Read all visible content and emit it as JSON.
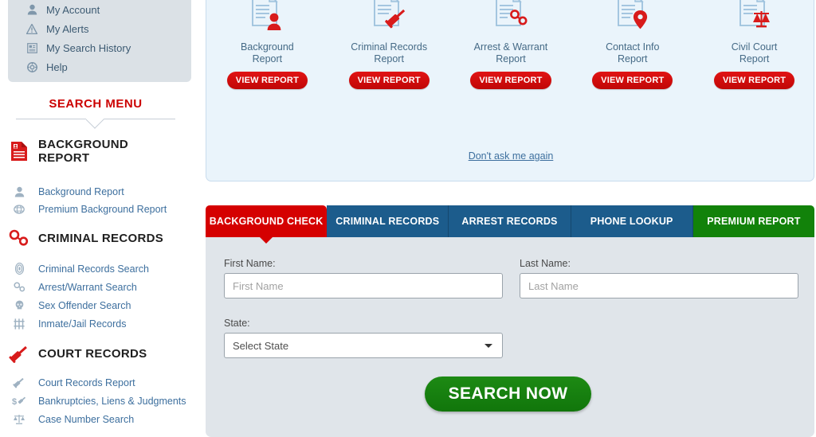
{
  "sidebar": {
    "account_items": [
      {
        "icon": "user-icon",
        "label": "My Account"
      },
      {
        "icon": "alert-triangle-icon",
        "label": "My Alerts"
      },
      {
        "icon": "history-list-icon",
        "label": "My Search History"
      },
      {
        "icon": "lifebuoy-help-icon",
        "label": "Help"
      }
    ],
    "search_menu_title": "SEARCH MENU",
    "sections": [
      {
        "icon": "background-report-document-icon",
        "title": "BACKGROUND REPORT",
        "items": [
          {
            "icon": "person-icon",
            "label": "Background Report"
          },
          {
            "icon": "globe-icon",
            "label": "Premium Background Report"
          }
        ]
      },
      {
        "icon": "handcuffs-icon",
        "title": "CRIMINAL RECORDS",
        "items": [
          {
            "icon": "fingerprint-icon",
            "label": "Criminal Records Search"
          },
          {
            "icon": "handcuffs-icon",
            "label": "Arrest/Warrant Search"
          },
          {
            "icon": "skull-icon",
            "label": "Sex Offender Search"
          },
          {
            "icon": "jail-bars-icon",
            "label": "Inmate/Jail Records"
          }
        ]
      },
      {
        "icon": "gavel-icon",
        "title": "COURT RECORDS",
        "items": [
          {
            "icon": "gavel-icon",
            "label": "Court Records Report"
          },
          {
            "icon": "money-gavel-icon",
            "label": "Bankruptcies, Liens & Judgments"
          },
          {
            "icon": "scales-justice-icon",
            "label": "Case Number Search"
          }
        ]
      }
    ]
  },
  "promo": {
    "cards": [
      {
        "icon": "document-person-icon",
        "title": "Background\nReport",
        "title_l1": "Background",
        "title_l2": "Report",
        "button": "VIEW REPORT"
      },
      {
        "icon": "document-gavel-icon",
        "title": "Criminal Records Report",
        "title_l1": "Criminal Records",
        "title_l2": "Report",
        "button": "VIEW REPORT"
      },
      {
        "icon": "document-handcuffs-icon",
        "title": "Arrest & Warrant Report",
        "title_l1": "Arrest & Warrant",
        "title_l2": "Report",
        "button": "VIEW REPORT"
      },
      {
        "icon": "document-pin-icon",
        "title": "Contact Info Report",
        "title_l1": "Contact Info",
        "title_l2": "Report",
        "button": "VIEW REPORT"
      },
      {
        "icon": "document-scales-icon",
        "title": "Civil Court Report",
        "title_l1": "Civil Court",
        "title_l2": "Report",
        "button": "VIEW REPORT"
      }
    ],
    "dont_ask_label": "Don't ask me again"
  },
  "tabs": [
    {
      "label": "BACKGROUND CHECK",
      "state": "active"
    },
    {
      "label": "CRIMINAL RECORDS",
      "state": "default"
    },
    {
      "label": "ARREST RECORDS",
      "state": "default"
    },
    {
      "label": "PHONE LOOKUP",
      "state": "default"
    },
    {
      "label": "PREMIUM REPORT",
      "state": "premium"
    }
  ],
  "form": {
    "first_name_label": "First Name:",
    "first_name_placeholder": "First Name",
    "first_name_value": "",
    "last_name_label": "Last Name:",
    "last_name_placeholder": "Last Name",
    "last_name_value": "",
    "state_label": "State:",
    "state_value": "Select State",
    "submit_label": "SEARCH NOW"
  },
  "colors": {
    "brand_red": "#cc0000",
    "tab_red": "#d50000",
    "tab_blue": "#1c5c8c",
    "tab_green": "#12820a",
    "link_blue": "#3d6f9e",
    "promo_bg": "#eaf4fb",
    "form_bg": "#e0e5ea"
  }
}
